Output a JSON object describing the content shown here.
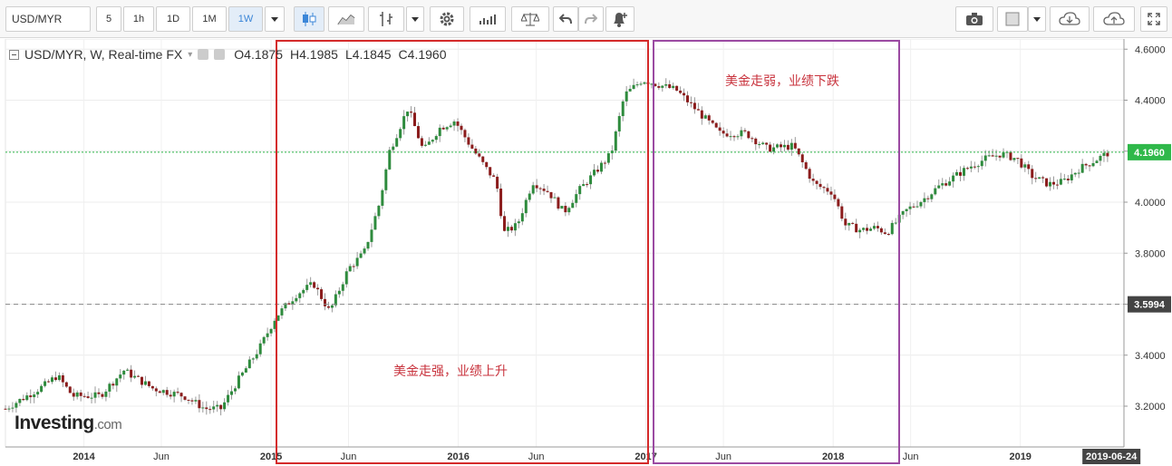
{
  "toolbar": {
    "symbol": "USD/MYR",
    "intervals": [
      "5",
      "1h",
      "1D",
      "1M",
      "1W"
    ],
    "active_interval": "1W",
    "icons": [
      "chevron-down-icon",
      "candlestick-icon",
      "line-chart-icon",
      "indicator-icon",
      "chevron-down-icon",
      "gear-icon",
      "bar-volume-icon",
      "balance-icon",
      "undo-icon",
      "redo-icon",
      "alert-bell-icon",
      "camera-icon",
      "color-box-icon",
      "chevron-down-icon",
      "cloud-download-icon",
      "cloud-upload-icon",
      "fullscreen-icon"
    ]
  },
  "legend": {
    "title": "USD/MYR, W, Real-time FX",
    "open": "O4.1875",
    "high": "H4.1985",
    "low": "L4.1845",
    "close": "C4.1960"
  },
  "logo": {
    "brand": "Investing",
    "suffix": ".com"
  },
  "annotations": {
    "strong": "美金走强，业绩上升",
    "weak": "美金走弱，业绩下跌"
  },
  "colors": {
    "up": "#2e8b3d",
    "down": "#8b1c1c",
    "box_strong": "#d42a2a",
    "box_weak": "#9b4aa2",
    "price_line": "#2fb84a",
    "ref_line": "#888888"
  },
  "chart_data": {
    "type": "candlestick",
    "title": "USD/MYR, W, Real-time FX",
    "ylim": [
      3.04,
      4.64
    ],
    "y_ticks": [
      3.2,
      3.4,
      3.6,
      3.8,
      4.0,
      4.2,
      4.4,
      4.6
    ],
    "y_tick_labels": [
      "3.2000",
      "3.4000",
      "3.6000",
      "3.8000",
      "4.0000",
      "4.2000",
      "4.4000",
      "4.6000"
    ],
    "x_start": "2013-08-01",
    "x_end": "2019-07-22",
    "x_ticks": [
      {
        "label": "2014",
        "date": "2014-01-01",
        "bold": true
      },
      {
        "label": "Jun",
        "date": "2014-06-01",
        "bold": false
      },
      {
        "label": "2015",
        "date": "2015-01-01",
        "bold": true
      },
      {
        "label": "Jun",
        "date": "2015-06-01",
        "bold": false
      },
      {
        "label": "2016",
        "date": "2016-01-01",
        "bold": true
      },
      {
        "label": "Jun",
        "date": "2016-06-01",
        "bold": false
      },
      {
        "label": "2017",
        "date": "2017-01-01",
        "bold": true
      },
      {
        "label": "Jun",
        "date": "2017-06-01",
        "bold": false
      },
      {
        "label": "2018",
        "date": "2018-01-01",
        "bold": true
      },
      {
        "label": "Jun",
        "date": "2018-06-01",
        "bold": false
      },
      {
        "label": "2019",
        "date": "2019-01-01",
        "bold": true
      }
    ],
    "last_date_label": "2019-06-24",
    "current_price": 4.196,
    "current_price_label": "4.1960",
    "ref_price": 3.5994,
    "ref_price_label": "3.5994",
    "path_points": [
      [
        "2013-08-01",
        3.19
      ],
      [
        "2013-10-15",
        3.28
      ],
      [
        "2013-11-10",
        3.32
      ],
      [
        "2013-12-10",
        3.24
      ],
      [
        "2014-02-01",
        3.24
      ],
      [
        "2014-03-01",
        3.3
      ],
      [
        "2014-03-20",
        3.34
      ],
      [
        "2014-05-15",
        3.27
      ],
      [
        "2014-07-15",
        3.24
      ],
      [
        "2014-08-25",
        3.19
      ],
      [
        "2014-09-25",
        3.19
      ],
      [
        "2014-10-25",
        3.29
      ],
      [
        "2014-12-10",
        3.43
      ],
      [
        "2015-01-10",
        3.55
      ],
      [
        "2015-02-20",
        3.64
      ],
      [
        "2015-03-25",
        3.68
      ],
      [
        "2015-04-25",
        3.57
      ],
      [
        "2015-06-01",
        3.74
      ],
      [
        "2015-07-01",
        3.8
      ],
      [
        "2015-08-01",
        4.0
      ],
      [
        "2015-08-20",
        4.2
      ],
      [
        "2015-09-25",
        4.37
      ],
      [
        "2015-10-25",
        4.2
      ],
      [
        "2015-11-25",
        4.29
      ],
      [
        "2015-12-25",
        4.32
      ],
      [
        "2016-01-25",
        4.22
      ],
      [
        "2016-02-25",
        4.13
      ],
      [
        "2016-03-15",
        4.08
      ],
      [
        "2016-03-30",
        3.88
      ],
      [
        "2016-04-25",
        3.91
      ],
      [
        "2016-05-25",
        4.08
      ],
      [
        "2016-06-25",
        4.04
      ],
      [
        "2016-07-25",
        3.96
      ],
      [
        "2016-08-25",
        4.05
      ],
      [
        "2016-09-25",
        4.12
      ],
      [
        "2016-10-25",
        4.19
      ],
      [
        "2016-11-20",
        4.42
      ],
      [
        "2016-12-25",
        4.48
      ],
      [
        "2017-03-01",
        4.44
      ],
      [
        "2017-04-25",
        4.33
      ],
      [
        "2017-05-25",
        4.27
      ],
      [
        "2017-07-15",
        4.27
      ],
      [
        "2017-08-25",
        4.21
      ],
      [
        "2017-10-15",
        4.22
      ],
      [
        "2017-11-25",
        4.07
      ],
      [
        "2017-12-30",
        4.04
      ],
      [
        "2018-01-25",
        3.91
      ],
      [
        "2018-02-25",
        3.89
      ],
      [
        "2018-03-25",
        3.9
      ],
      [
        "2018-04-15",
        3.88
      ],
      [
        "2018-05-25",
        3.97
      ],
      [
        "2018-06-25",
        4.01
      ],
      [
        "2018-07-25",
        4.06
      ],
      [
        "2018-08-25",
        4.1
      ],
      [
        "2018-09-25",
        4.14
      ],
      [
        "2018-10-25",
        4.17
      ],
      [
        "2018-11-25",
        4.19
      ],
      [
        "2018-12-25",
        4.17
      ],
      [
        "2019-01-25",
        4.1
      ],
      [
        "2019-02-25",
        4.07
      ],
      [
        "2019-03-25",
        4.08
      ],
      [
        "2019-04-25",
        4.13
      ],
      [
        "2019-06-24",
        4.196
      ]
    ]
  }
}
